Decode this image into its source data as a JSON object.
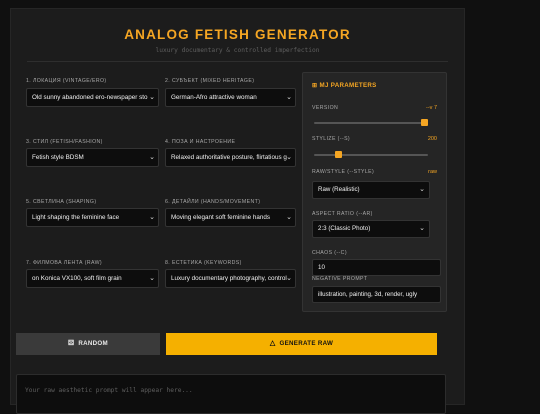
{
  "header": {
    "title": "ANALOG FETISH GENERATOR",
    "subtitle": "luxury documentary & controlled imperfection"
  },
  "fields": [
    {
      "label": "1. ЛОКАЦИЯ (VINTAGE/ERO)",
      "value": "Old sunny abandoned ero-newspaper sto"
    },
    {
      "label": "2. СУБЪЕКТ (MIXED HERITAGE)",
      "value": "German-Afro attractive woman"
    },
    {
      "label": "3. СТИЛ (FETISH/FASHION)",
      "value": "Fetish style BDSM"
    },
    {
      "label": "4. ПОЗА И НАСТРОЕНИЕ",
      "value": "Relaxed authoritative posture, flirtatious g"
    },
    {
      "label": "5. СВЕТЛИНА (SHAPING)",
      "value": "Light shaping the feminine face"
    },
    {
      "label": "6. ДЕТАЙЛИ (HANDS/MOVEMENT)",
      "value": "Moving elegant soft feminine hands"
    },
    {
      "label": "7. ФИЛМОВА ЛЕНТА (RAW)",
      "value": "on Konica VX100, soft film grain"
    },
    {
      "label": "8. ЕСТЕТИКА (KEYWORDS)",
      "value": "Luxury documentary photography, control"
    }
  ],
  "mj": {
    "title": "MJ PARAMETERS",
    "version_label": "VERSION",
    "version_value": "--v 7",
    "version_level": 1.0,
    "stylize_label": "STYLIZE (--S)",
    "stylize_value": "200",
    "stylize_level": 0.2,
    "rawstyle_label": "RAW/STYLE (--STYLE)",
    "rawstyle_value": "raw",
    "rawstyle_select": "Raw (Realistic)",
    "ar_label": "ASPECT RATIO (--AR)",
    "ar_select": "2:3 (Classic Photo)",
    "chaos_label": "CHAOS (--C)",
    "chaos_value": "10",
    "neg_label": "NEGATIVE PROMPT",
    "neg_value": "illustration, painting, 3d, render, ugly"
  },
  "buttons": {
    "random_label": "RANDOM",
    "generate_label": "GENERATE RAW"
  },
  "output": {
    "placeholder": "Your raw aesthetic prompt will appear here..."
  },
  "colors": {
    "accent": "#f5a623",
    "generate_button": "#f5b000",
    "background": "#101010",
    "panel": "#1c1c1c"
  },
  "icons": {
    "mj_title": "grid-icon",
    "random": "dice-icon",
    "generate": "flame-icon",
    "select": "chevron-down-icon"
  }
}
